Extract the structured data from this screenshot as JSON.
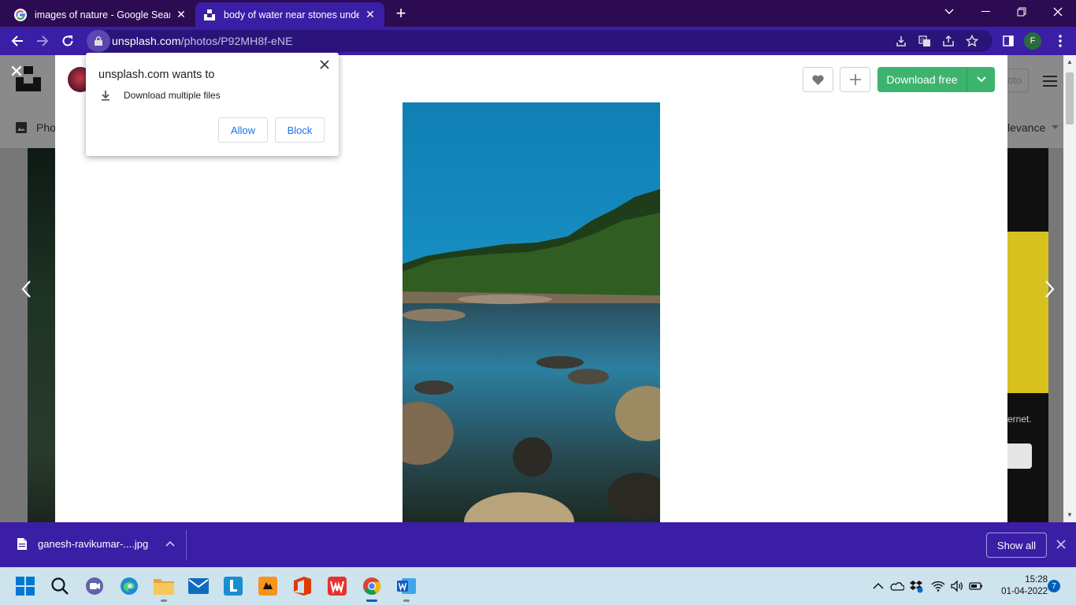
{
  "browser": {
    "tabs": [
      {
        "title": "images of nature - Google Search",
        "active": false,
        "favicon": "google-icon"
      },
      {
        "title": "body of water near stones under",
        "active": true,
        "favicon": "unsplash-icon"
      }
    ],
    "url_domain": "unsplash.com",
    "url_path": "/photos/P92MH8f-eNE",
    "profile_initial": "F",
    "accent_color": "#3b1ea6",
    "tabstrip_color": "#2d0b52"
  },
  "permission_popup": {
    "title": "unsplash.com wants to",
    "request": "Download multiple files",
    "allow_label": "Allow",
    "block_label": "Block"
  },
  "page": {
    "download_label": "Download free",
    "download_color": "#3cb46e",
    "background_fragments": {
      "photos_tab": "Pho",
      "sort_label": "levance",
      "right_text": "ernet.",
      "top_right_button": "oto"
    }
  },
  "download_shelf": {
    "filename": "ganesh-ravikumar-....jpg",
    "show_all_label": "Show all"
  },
  "taskbar": {
    "apps": [
      "start-icon",
      "search-icon",
      "teams-icon",
      "edge-icon",
      "file-explorer-icon",
      "mail-icon",
      "l-app-icon",
      "game-icon",
      "office-icon",
      "wps-icon",
      "chrome-icon",
      "word-icon"
    ],
    "time": "15:28",
    "date": "01-04-2022",
    "notification_count": "7"
  }
}
